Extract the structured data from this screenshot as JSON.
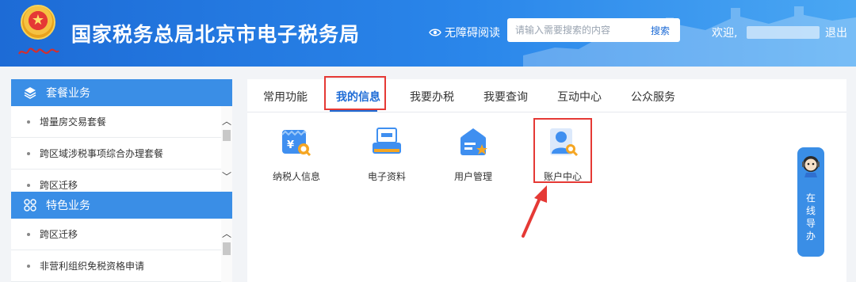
{
  "header": {
    "title": "国家税务总局北京市电子税务局",
    "accessibility_label": "无障碍阅读",
    "search_placeholder": "请输入需要搜索的内容",
    "search_button": "搜索",
    "welcome": "欢迎,",
    "logout": "退出",
    "colors": {
      "brand_blue": "#1d6bd6",
      "light_blue": "#4aa7f3"
    }
  },
  "sidebar": {
    "groups": [
      {
        "label": "套餐业务",
        "icon": "layers-icon",
        "items": [
          "增量房交易套餐",
          "跨区域涉税事项综合办理套餐",
          "跨区迁移"
        ]
      },
      {
        "label": "特色业务",
        "icon": "grid-cross-icon",
        "items": [
          "跨区迁移",
          "非营利组织免税资格申请"
        ]
      }
    ]
  },
  "main": {
    "tabs": [
      {
        "label": "常用功能",
        "active": false
      },
      {
        "label": "我的信息",
        "active": true
      },
      {
        "label": "我要办税",
        "active": false
      },
      {
        "label": "我要查询",
        "active": false
      },
      {
        "label": "互动中心",
        "active": false
      },
      {
        "label": "公众服务",
        "active": false
      }
    ],
    "tiles": [
      {
        "label": "纳税人信息",
        "icon": "taxpayer-info-icon"
      },
      {
        "label": "电子资料",
        "icon": "e-documents-icon"
      },
      {
        "label": "用户管理",
        "icon": "user-management-icon"
      },
      {
        "label": "账户中心",
        "icon": "account-center-icon"
      }
    ],
    "highlight_color": "#e53935"
  },
  "guide": {
    "label_chars": [
      "在",
      "线",
      "导",
      "办"
    ],
    "icon": "robot-icon"
  }
}
